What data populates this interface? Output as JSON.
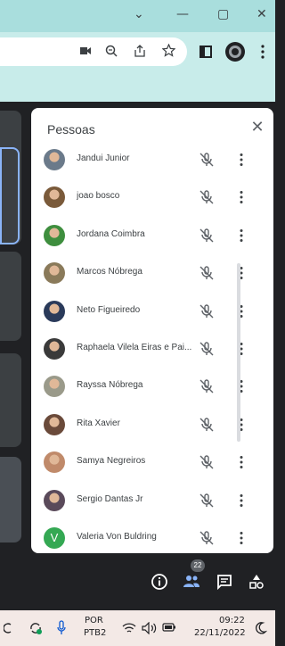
{
  "window": {
    "minimize_glyph": "—",
    "maximize_glyph": "▢",
    "close_glyph": "✕",
    "tabs_glyph": "⌄"
  },
  "browser": {
    "icons": [
      "camera-icon",
      "zoom-icon",
      "share-icon",
      "star-icon",
      "sidepanel-icon",
      "profile-icon",
      "menu-icon"
    ]
  },
  "panel": {
    "title": "Pessoas",
    "close_label": "✕",
    "participants": [
      {
        "name": "Jandui Junior",
        "avatar": "photo",
        "color": "#6b7a8a"
      },
      {
        "name": "joao bosco",
        "avatar": "photo",
        "color": "#7a5a3a"
      },
      {
        "name": "Jordana Coimbra",
        "avatar": "photo",
        "color": "#3e8e3e"
      },
      {
        "name": "Marcos Nóbrega",
        "avatar": "photo",
        "color": "#8a7a5a"
      },
      {
        "name": "Neto Figueiredo",
        "avatar": "photo",
        "color": "#2a3a5a"
      },
      {
        "name": "Raphaela Vilela Eiras e Pai...",
        "avatar": "photo",
        "color": "#3a3a3a"
      },
      {
        "name": "Rayssa Nóbrega",
        "avatar": "photo",
        "color": "#9a9a8a"
      },
      {
        "name": "Rita Xavier",
        "avatar": "photo",
        "color": "#6a4a3a"
      },
      {
        "name": "Samya Negreiros",
        "avatar": "photo",
        "color": "#c08a6a"
      },
      {
        "name": "Sergio Dantas Jr",
        "avatar": "photo",
        "color": "#5a4a5a"
      },
      {
        "name": "Valeria Von Buldring",
        "avatar": "letter",
        "letter": "V",
        "color": "#34a853"
      }
    ]
  },
  "controls": {
    "people_count": "22"
  },
  "taskbar": {
    "lang_top": "POR",
    "lang_bottom": "PTB2",
    "time": "09:22",
    "date": "22/11/2022"
  }
}
